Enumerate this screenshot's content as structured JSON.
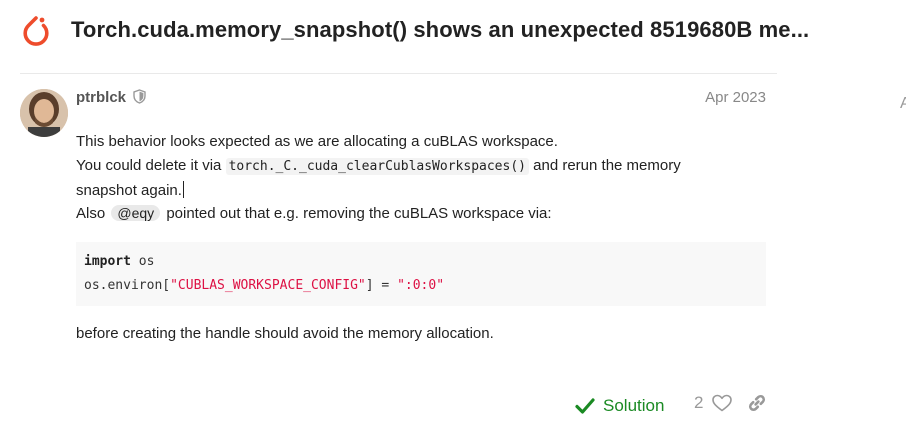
{
  "header": {
    "title": "Torch.cuda.memory_snapshot() shows an unexpected 8519680B me...",
    "brand_color": "#ee4c2c"
  },
  "timeline": {
    "stub_text": "A"
  },
  "post": {
    "username": "ptrblck",
    "date": "Apr 2023",
    "line1": "This behavior looks expected as we are allocating a cuBLAS workspace.",
    "line2_prefix": "You could delete it via ",
    "line2_code": "torch._C._cuda_clearCublasWorkspaces()",
    "line2_suffix": " and rerun the memory",
    "line3": "snapshot again.",
    "line4_prefix": "Also ",
    "mention": "@eqy",
    "line4_suffix": " pointed out that e.g. removing the cuBLAS workspace via:",
    "code": {
      "l1_keyword": "import",
      "l1_rest": " os",
      "l2_prefix": "os.environ[",
      "l2_key": "\"CUBLAS_WORKSPACE_CONFIG\"",
      "l2_mid": "] = ",
      "l2_value": "\":0:0\""
    },
    "line5": "before creating the handle should avoid the memory allocation."
  },
  "actions": {
    "solution_label": "Solution",
    "solution_color": "#1a8a23",
    "like_count": "2"
  },
  "icons": [
    "pytorch-logo-icon",
    "shield-icon",
    "check-icon",
    "heart-icon",
    "link-icon"
  ]
}
